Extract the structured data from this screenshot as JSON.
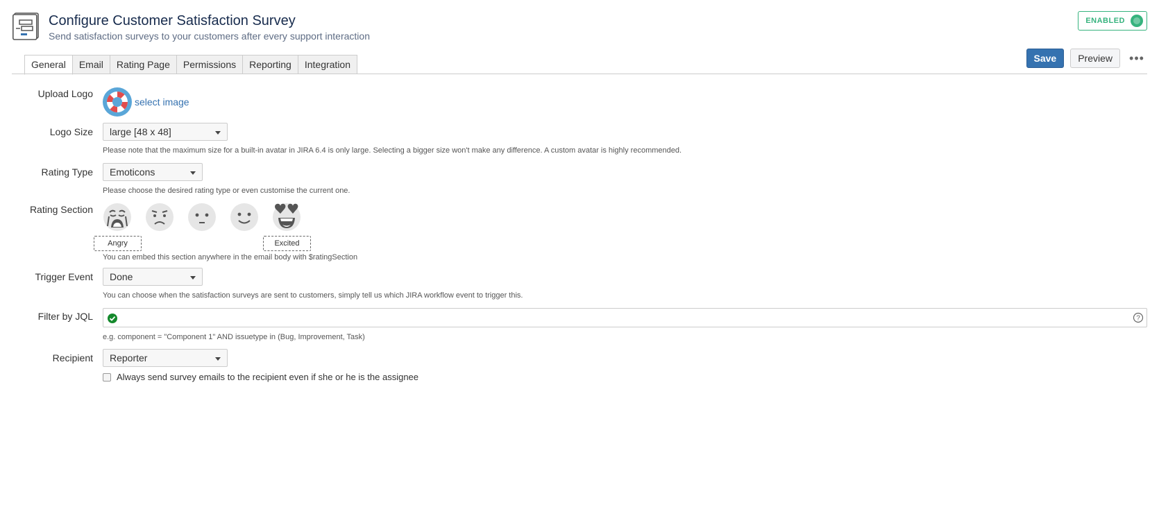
{
  "header": {
    "title": "Configure Customer Satisfaction Survey",
    "subtitle": "Send satisfaction surveys to your customers after every support interaction",
    "status": "ENABLED",
    "page_icon": "survey-form-icon"
  },
  "tabs": [
    {
      "label": "General",
      "active": true
    },
    {
      "label": "Email"
    },
    {
      "label": "Rating Page"
    },
    {
      "label": "Permissions"
    },
    {
      "label": "Reporting"
    },
    {
      "label": "Integration"
    }
  ],
  "toolbar": {
    "save": "Save",
    "preview": "Preview",
    "more": "•••"
  },
  "form": {
    "upload_logo": {
      "label": "Upload Logo",
      "link": "select image",
      "icon": "lifebuoy-icon"
    },
    "logo_size": {
      "label": "Logo Size",
      "value": "large [48 x 48]",
      "help": "Please note that the maximum size for a built-in avatar in JIRA 6.4 is only large. Selecting a bigger size won't make any difference. A custom avatar is highly recommended."
    },
    "rating_type": {
      "label": "Rating Type",
      "value": "Emoticons",
      "help": "Please choose the desired rating type or even customise the current one."
    },
    "rating_section": {
      "label": "Rating Section",
      "emoticons": [
        "crying-face-icon",
        "sad-face-icon",
        "neutral-face-icon",
        "smiling-face-icon",
        "heart-eyes-face-icon"
      ],
      "low_label": "Angry",
      "high_label": "Excited",
      "help": "You can embed this section anywhere in the email body with $ratingSection"
    },
    "trigger_event": {
      "label": "Trigger Event",
      "value": "Done",
      "help": "You can choose when the satisfaction surveys are sent to customers, simply tell us which JIRA workflow event to trigger this."
    },
    "filter_jql": {
      "label": "Filter by JQL",
      "value": "",
      "help": "e.g. component = \"Component 1\" AND issuetype in (Bug, Improvement, Task)"
    },
    "recipient": {
      "label": "Recipient",
      "value": "Reporter",
      "checkbox": "Always send survey emails to the recipient even if she or he is the assignee",
      "checked": false
    }
  },
  "colors": {
    "primary": "#3572b0",
    "enabled": "#36b37e",
    "link": "#3572b0"
  }
}
